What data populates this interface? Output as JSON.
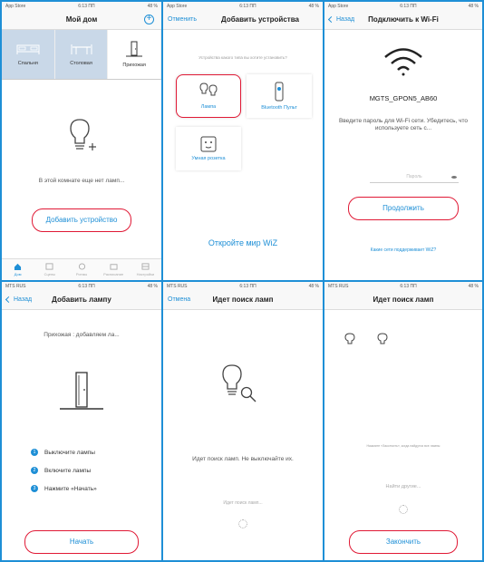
{
  "status_bar": {
    "carrier_appstore": "App Store",
    "carrier_mts": "MTS RUS",
    "time": "6:13 ПП",
    "battery": "48 %"
  },
  "colors": {
    "accent": "#1e8fd6",
    "highlight": "#e01935",
    "room_tile": "#c9d8e8"
  },
  "panel1": {
    "title": "Мой дом",
    "rooms": [
      "Спальня",
      "Столовая",
      "Прихожая"
    ],
    "empty_text": "В этой комнате еще нет ламп...",
    "add_button": "Добавить устройство",
    "tabs": [
      "Дом",
      "Сцены",
      "Ритмы",
      "Расписание",
      "Настройки"
    ]
  },
  "panel2": {
    "cancel": "Отменить",
    "title": "Добавить устройства",
    "question": "Устройства какого типа вы хотите установить?",
    "devices": [
      "Лампа",
      "Bluetooth Пульт",
      "Умная розетка"
    ],
    "discover_link": "Откройте мир WiZ"
  },
  "panel3": {
    "back": "Назад",
    "title": "Подключить к Wi-Fi",
    "ssid": "MGTS_GPON5_AB60",
    "instructions": "Введите пароль для Wi-Fi сети. Убедитесь, что используете сеть с...",
    "password_placeholder": "Пароль",
    "continue_button": "Продолжить",
    "supported_link": "Какие сети поддерживает WiZ?"
  },
  "panel4": {
    "back": "Назад",
    "title": "Добавить лампу",
    "subtitle": "Прихожая : добавляем ла...",
    "steps": [
      "Выключите лампы",
      "Включите лампы",
      "Нажмите «Начать»"
    ],
    "start_button": "Начать"
  },
  "panel5": {
    "cancel": "Отмена",
    "title": "Идет поиск ламп",
    "message": "Идет поиск ламп. Не выключайте их.",
    "progress_text": "Идет поиск ламп..."
  },
  "panel6": {
    "title": "Идет поиск ламп",
    "found_text": "Нажмите «Закончить», когда найдутся все лампы",
    "search_other": "Найти другие...",
    "finish_button": "Закончить"
  }
}
